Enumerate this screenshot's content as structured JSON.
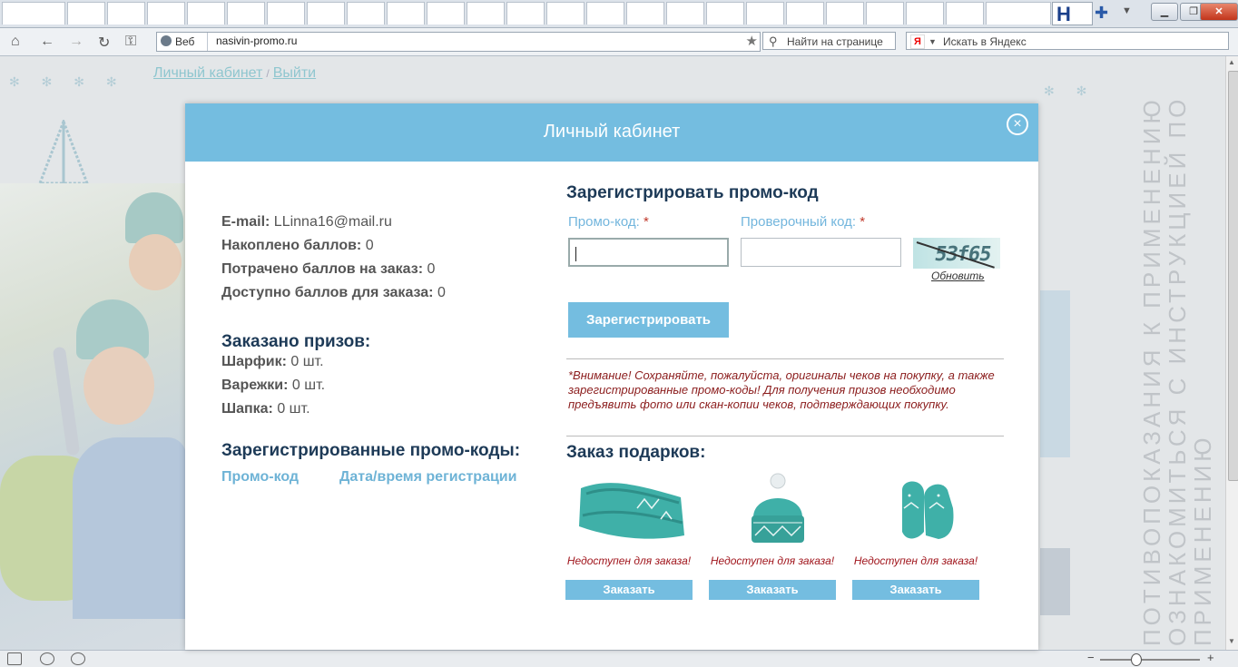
{
  "browser": {
    "active_tab_letter": "H",
    "address_badge": "Веб",
    "address": "nasivin-promo.ru",
    "find_placeholder": "Найти на странице",
    "yandex_logo": "Я",
    "yandex_placeholder": "Искать в Яндекс"
  },
  "page": {
    "breadcrumb": {
      "cabinet": "Личный кабинет",
      "separator": "/",
      "logout": "Выйти"
    },
    "vertical_text": "ПОТИВОПОКАЗАНИЯ К ПРИМЕНЕНИЮ ОЗНАКОМИТЬСЯ С ИНСТРУКЦИЕЙ ПО ПРИМЕНЕНИЮ"
  },
  "modal": {
    "title": "Личный кабинет",
    "profile": {
      "email_label": "E-mail:",
      "email_value": "LLinna16@mail.ru",
      "accumulated_label": "Накоплено баллов:",
      "accumulated_value": "0",
      "spent_label": "Потрачено баллов на заказ:",
      "spent_value": "0",
      "available_label": "Доступно баллов для заказа:",
      "available_value": "0"
    },
    "ordered": {
      "title": "Заказано призов:",
      "items": [
        {
          "label": "Шарфик:",
          "value": "0 шт."
        },
        {
          "label": "Варежки:",
          "value": "0 шт."
        },
        {
          "label": "Шапка:",
          "value": "0 шт."
        }
      ]
    },
    "registered_codes": {
      "title": "Зарегистрированные промо-коды:",
      "col_code": "Промо-код",
      "col_date": "Дата/время регистрации"
    },
    "register": {
      "title": "Зарегистрировать промо-код",
      "code_label": "Промо-код:",
      "check_label": "Проверочный код:",
      "required_mark": "*",
      "captcha_text": "53f65",
      "refresh": "Обновить",
      "button": "Зарегистрировать"
    },
    "warning": "*Внимание! Сохраняйте, пожалуйста, оригиналы чеков на покупку, а также зарегистрированные промо-коды! Для получения призов необходимо предъявить фото или скан-копии чеков, подтверждающих покупку.",
    "gifts": {
      "title": "Заказ подарков:",
      "items": [
        {
          "status": "Недоступен для заказа!",
          "button": "Заказать",
          "icon": "scarf-image"
        },
        {
          "status": "Недоступен для заказа!",
          "button": "Заказать",
          "icon": "hat-image"
        },
        {
          "status": "Недоступен для заказа!",
          "button": "Заказать",
          "icon": "mittens-image"
        }
      ]
    }
  },
  "colors": {
    "accent": "#74bde0",
    "heading": "#1d3a57",
    "warning": "#8b1c1c",
    "gift": "#3fb0a8"
  }
}
